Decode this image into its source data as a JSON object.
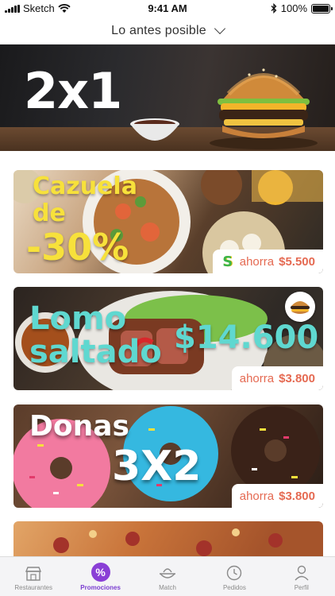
{
  "status_bar": {
    "carrier": "Sketch",
    "time": "9:41 AM",
    "battery": "100%",
    "battery_level": 1.0,
    "icons": [
      "signal-icon",
      "wifi-icon",
      "bluetooth-icon",
      "battery-icon"
    ]
  },
  "header": {
    "delivery_time": "Lo antes posible",
    "icon": "chevron-down-icon"
  },
  "hero": {
    "title": "2x1",
    "carousel_total": 4,
    "carousel_active": 1
  },
  "promos": [
    {
      "title_lines": [
        "Cazuela",
        "de",
        "-30%"
      ],
      "save_label": "ahorra",
      "save_amount": "$5.500",
      "text_color": "#f7e13b",
      "brand_icon": "s-brand-icon"
    },
    {
      "title_lines": [
        "Lomo",
        "saltado"
      ],
      "price": "$14.600",
      "save_label": "ahorra",
      "save_amount": "$3.800",
      "text_color": "#5fd8d0",
      "brand_icon": "burger-brand-icon"
    },
    {
      "title_lines": [
        "Donas"
      ],
      "deal": "3X2",
      "save_label": "ahorra",
      "save_amount": "$3.800",
      "text_color": "#ffffff"
    }
  ],
  "tabbar": {
    "active": "Promociones",
    "active_color": "#7b3fd0",
    "items": [
      {
        "label": "Restaurantes",
        "icon": "store-icon"
      },
      {
        "label": "Promociones",
        "icon": "percent-icon"
      },
      {
        "label": "Match",
        "icon": "match-icon"
      },
      {
        "label": "Pedidos",
        "icon": "clock-icon"
      },
      {
        "label": "Perfil",
        "icon": "user-icon"
      }
    ]
  },
  "colors": {
    "accent": "#7b3fd0",
    "savings": "#e56a52"
  }
}
